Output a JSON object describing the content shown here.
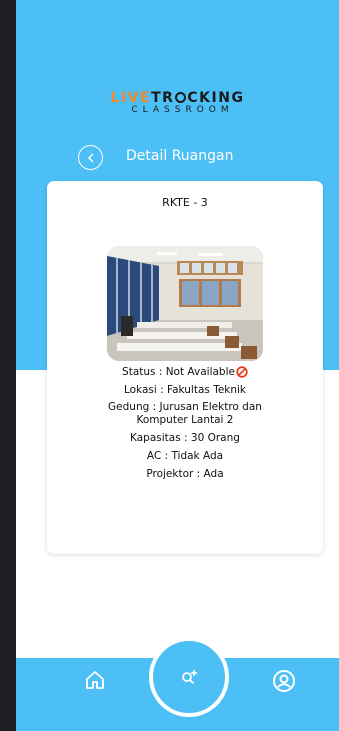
{
  "app": {
    "logo_part1": "LIVE",
    "logo_part2": "TR",
    "logo_part3": "CKING",
    "logo_sub": "CLASSROOM"
  },
  "header": {
    "title": "Detail Ruangan",
    "back_icon": "chevron-left-icon"
  },
  "room": {
    "code": "RKTE - 3",
    "status": "Status : Not Available",
    "status_icon": "no-entry-icon",
    "lokasi": "Lokasi : Fakultas Teknik",
    "gedung": "Gedung : Jurusan Elektro dan Komputer Lantai 2",
    "kapasitas": "Kapasitas : 30 Orang",
    "ac": "AC : Tidak Ada",
    "projektor": "Projektor : Ada"
  },
  "nav": {
    "home_icon": "home-icon",
    "search_icon": "search-add-icon",
    "profile_icon": "user-icon"
  },
  "colors": {
    "primary": "#4cc0f6",
    "accent": "#f08a2b",
    "status_red": "#e8401c"
  }
}
